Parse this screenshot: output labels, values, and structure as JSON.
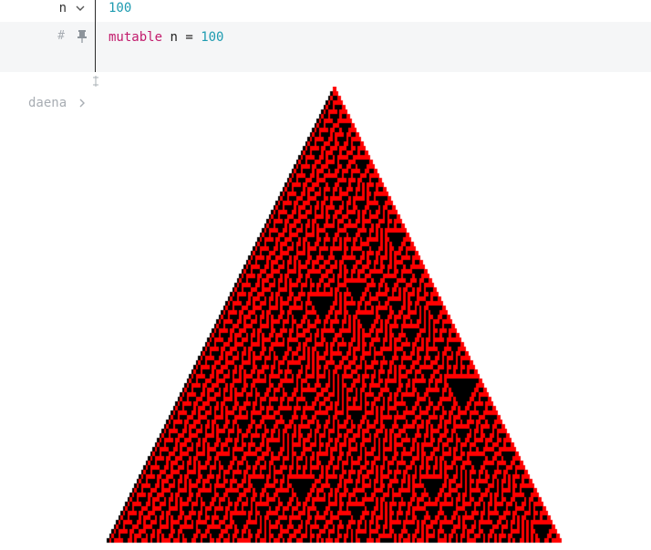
{
  "cells": [
    {
      "name": "n",
      "output_value": "100",
      "code": {
        "keyword": "mutable",
        "identifier": "n",
        "operator": "=",
        "value": "100"
      },
      "gutter_icons": [
        "hash-icon",
        "pin-icon"
      ]
    },
    {
      "name": "daena",
      "collapsed_icon": "chevron-right-icon"
    }
  ],
  "automaton": {
    "rows": 100,
    "on_color": "#ff0000",
    "off_color": "#000000",
    "background": "#ffffff"
  },
  "colors": {
    "keyword": "#c21b6c",
    "number": "#1d9bb0",
    "code_background": "#f5f6f7",
    "muted": "#a8adb3"
  }
}
